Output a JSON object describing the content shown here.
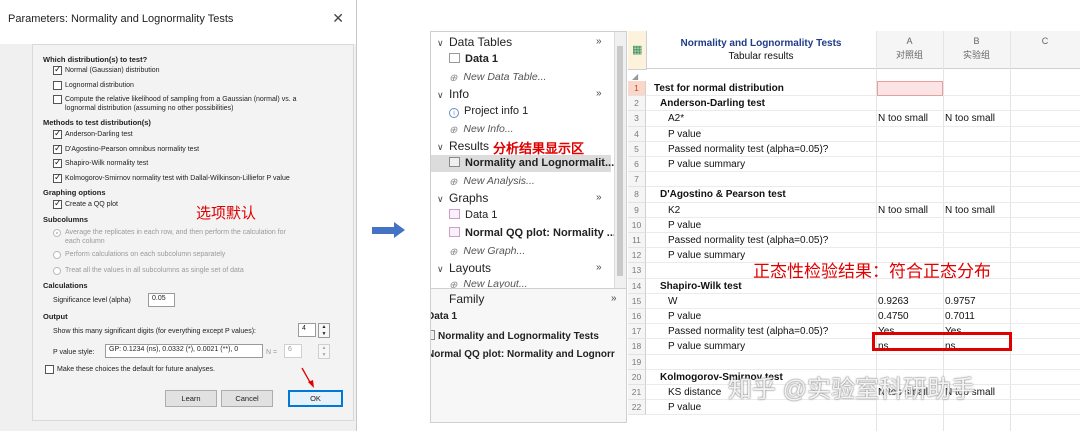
{
  "dialog": {
    "title": "Parameters: Normality and Lognormality Tests",
    "close_glyph": "✕",
    "which_header": "Which distribution(s) to test?",
    "dist_options": [
      {
        "label": "Normal (Gaussian) distribution",
        "checked": true
      },
      {
        "label": "Lognormal distribution",
        "checked": false
      },
      {
        "label": "Compute the relative likelihood of sampling from a Gaussian (normal) vs. a",
        "checked": false
      }
    ],
    "dist_option3_line2": "lognormal distribution (assuming no other possibilities)",
    "methods_header": "Methods to test distribution(s)",
    "methods": [
      {
        "label": "Anderson-Darling test",
        "checked": true
      },
      {
        "label": "D'Agostino-Pearson omnibus normality test",
        "checked": true
      },
      {
        "label": "Shapiro-Wilk normality test",
        "checked": true
      },
      {
        "label": "Kolmogorov-Smirnov normality test with Dallal-Wilkinson-Lilliefor P value",
        "checked": true
      }
    ],
    "graphing_header": "Graphing options",
    "create_qq_label": "Create a QQ plot",
    "annotation": "选项默认",
    "subcolumns_header": "Subcolumns",
    "sub_option1_line1": "Average the replicates in each row, and then perform the calculation for",
    "sub_option1_line2": "each column",
    "sub_option2": "Perform calculations on each subcolumn separately",
    "sub_option3": "Treat all the values in all subcolumns as single set of data",
    "calculations_header": "Calculations",
    "alpha_label": "Significance level (alpha)",
    "alpha_value": "0.05",
    "output_header": "Output",
    "digits_label": "Show this many significant digits (for everything except P values):",
    "digits_value": "4",
    "pstyle_label": "P value style:",
    "pstyle_value": "GP: 0.1234 (ns), 0.0332 (*), 0.0021 (**), 0",
    "pstyle_n_label": "N =",
    "pstyle_n_value": "6",
    "default_label": "Make these choices the default for future analyses.",
    "learn_button": "Learn",
    "cancel_button": "Cancel",
    "ok_button": "OK"
  },
  "navigator": {
    "data_tables": "Data Tables",
    "data1": "Data 1",
    "new_data_table": "New Data Table...",
    "info": "Info",
    "project_info": "Project info 1",
    "new_info": "New Info...",
    "results": "Results",
    "results_annotation": "分析结果显示区",
    "results_item": "Normality and Lognormalit...",
    "new_analysis": "New Analysis...",
    "graphs": "Graphs",
    "graph_data1": "Data 1",
    "graph_qq": "Normal QQ plot: Normality ...",
    "new_graph": "New Graph...",
    "layouts": "Layouts",
    "new_layout": "New Layout...",
    "expand_glyph": "»",
    "family": "Family",
    "family_items": [
      "Data 1",
      "Normality and Lognormality Tests",
      "Normal QQ plot: Normality and Lognorr"
    ]
  },
  "sheet": {
    "title": "Normality and Lognormality Tests",
    "subtitle": "Tabular results",
    "col_letters": [
      "A",
      "B",
      "C"
    ],
    "col_names": [
      "对照组",
      "实验组"
    ],
    "rows": [
      {
        "n": "1",
        "label": "Test for normal distribution",
        "bold": true,
        "indent": 0,
        "a": "",
        "b": ""
      },
      {
        "n": "2",
        "label": "Anderson-Darling test",
        "bold": true,
        "indent": 1,
        "a": "",
        "b": ""
      },
      {
        "n": "3",
        "label": "A2*",
        "bold": false,
        "indent": 2,
        "a": "N too small",
        "b": "N too small"
      },
      {
        "n": "4",
        "label": "P value",
        "bold": false,
        "indent": 2,
        "a": "",
        "b": ""
      },
      {
        "n": "5",
        "label": "Passed normality test (alpha=0.05)?",
        "bold": false,
        "indent": 2,
        "a": "",
        "b": ""
      },
      {
        "n": "6",
        "label": "P value summary",
        "bold": false,
        "indent": 2,
        "a": "",
        "b": ""
      },
      {
        "n": "7",
        "label": "",
        "bold": false,
        "indent": 0,
        "a": "",
        "b": ""
      },
      {
        "n": "8",
        "label": "D'Agostino & Pearson test",
        "bold": true,
        "indent": 1,
        "a": "",
        "b": ""
      },
      {
        "n": "9",
        "label": "K2",
        "bold": false,
        "indent": 2,
        "a": "N too small",
        "b": "N too small"
      },
      {
        "n": "10",
        "label": "P value",
        "bold": false,
        "indent": 2,
        "a": "",
        "b": ""
      },
      {
        "n": "11",
        "label": "Passed normality test (alpha=0.05)?",
        "bold": false,
        "indent": 2,
        "a": "",
        "b": ""
      },
      {
        "n": "12",
        "label": "P value summary",
        "bold": false,
        "indent": 2,
        "a": "",
        "b": ""
      },
      {
        "n": "13",
        "label": "",
        "bold": false,
        "indent": 0,
        "a": "",
        "b": ""
      },
      {
        "n": "14",
        "label": "Shapiro-Wilk test",
        "bold": true,
        "indent": 1,
        "a": "",
        "b": ""
      },
      {
        "n": "15",
        "label": "W",
        "bold": false,
        "indent": 2,
        "a": "0.9263",
        "b": "0.9757"
      },
      {
        "n": "16",
        "label": "P value",
        "bold": false,
        "indent": 2,
        "a": "0.4750",
        "b": "0.7011"
      },
      {
        "n": "17",
        "label": "Passed normality test (alpha=0.05)?",
        "bold": false,
        "indent": 2,
        "a": "Yes",
        "b": "Yes"
      },
      {
        "n": "18",
        "label": "P value summary",
        "bold": false,
        "indent": 2,
        "a": "ns",
        "b": "ns"
      },
      {
        "n": "19",
        "label": "",
        "bold": false,
        "indent": 0,
        "a": "",
        "b": ""
      },
      {
        "n": "20",
        "label": "Kolmogorov-Smirnov test",
        "bold": true,
        "indent": 1,
        "a": "",
        "b": ""
      },
      {
        "n": "21",
        "label": "KS distance",
        "bold": false,
        "indent": 2,
        "a": "N too small",
        "b": "N too small"
      },
      {
        "n": "22",
        "label": "P value",
        "bold": false,
        "indent": 2,
        "a": "",
        "b": ""
      }
    ],
    "annotation": "正态性检验结果：符合正态分布",
    "watermark": "知乎 @实验室科研助手"
  }
}
